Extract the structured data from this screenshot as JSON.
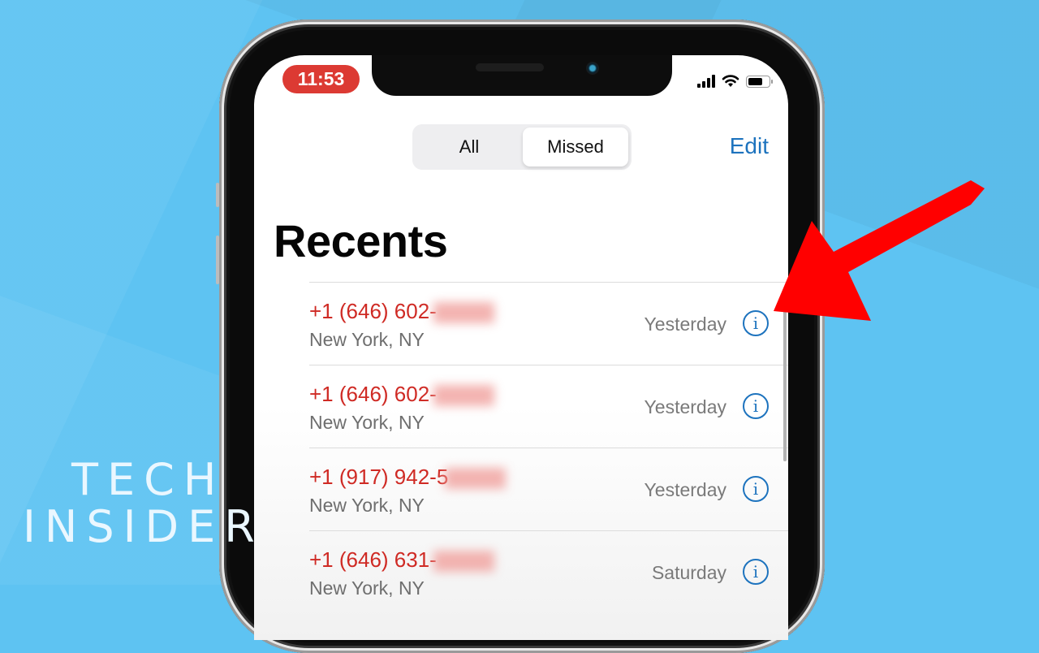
{
  "status_bar": {
    "time": "11:53",
    "icons": [
      "cellular-signal-icon",
      "wifi-icon",
      "battery-icon"
    ]
  },
  "header": {
    "segments": [
      {
        "label": "All",
        "selected": false
      },
      {
        "label": "Missed",
        "selected": true
      }
    ],
    "edit_label": "Edit"
  },
  "title": "Recents",
  "calls": [
    {
      "number": "+1 (646) 602-",
      "location": "New York, NY",
      "date": "Yesterday",
      "icon": "info-icon"
    },
    {
      "number": "+1 (646) 602-",
      "location": "New York, NY",
      "date": "Yesterday",
      "icon": "info-icon"
    },
    {
      "number": "+1 (917) 942-5",
      "location": "New York, NY",
      "date": "Yesterday",
      "icon": "info-icon"
    },
    {
      "number": "+1 (646) 631-",
      "location": "New York, NY",
      "date": "Saturday",
      "icon": "info-icon"
    }
  ],
  "overlay": {
    "brand_line1": "TECH",
    "brand_line2": "INSIDER",
    "arrow_color": "#ff0000"
  },
  "colors": {
    "background": "#5ec3f2",
    "missed_call": "#cf2a24",
    "accent_blue": "#1d73be",
    "time_pill": "#dc3a33"
  }
}
